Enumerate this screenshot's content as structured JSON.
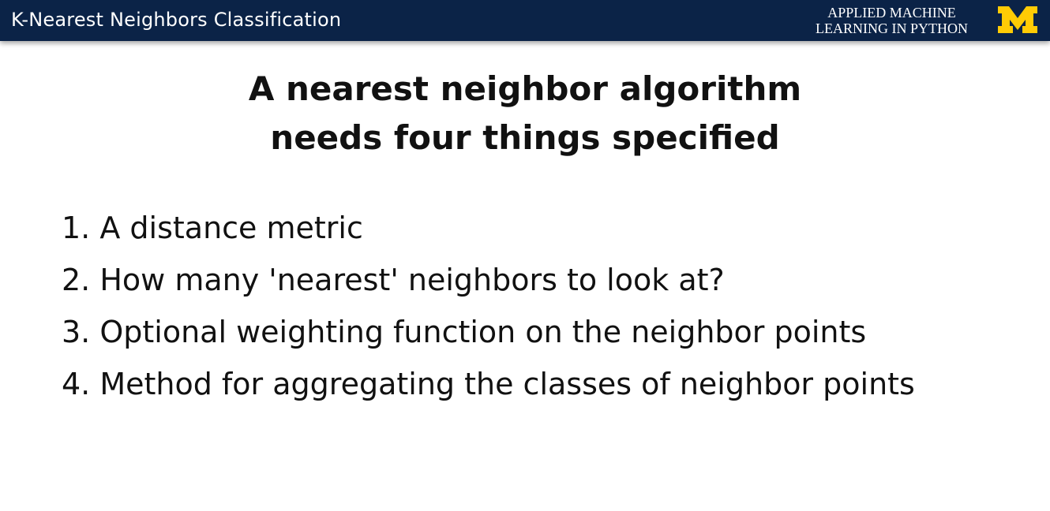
{
  "header": {
    "title": "K-Nearest Neighbors Classification",
    "course_line1": "APPLIED MACHINE",
    "course_line2": "LEARNING IN PYTHON",
    "logo_color": "#ffcb05",
    "bar_color": "#0b2347",
    "logo": "block-m-logo"
  },
  "slide": {
    "title_line1": "A nearest neighbor algorithm",
    "title_line2": "needs four things specified",
    "items": [
      "1. A distance metric",
      "2. How many 'nearest' neighbors to look at?",
      "3. Optional weighting function on the neighbor points",
      "4. Method for aggregating the classes of neighbor points"
    ]
  }
}
